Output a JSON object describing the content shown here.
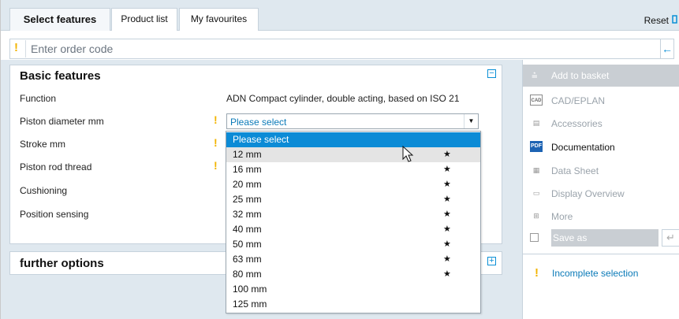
{
  "tabs": [
    {
      "label": "Select features",
      "active": true
    },
    {
      "label": "Product list",
      "active": false
    },
    {
      "label": "My favourites",
      "active": false
    }
  ],
  "reset_label": "Reset",
  "order_code": {
    "placeholder": "Enter order code",
    "value": ""
  },
  "basic_features": {
    "title": "Basic features",
    "rows": [
      {
        "label": "Function",
        "value": "ADN Compact cylinder, double acting, based on ISO 21",
        "required": false
      },
      {
        "label": "Piston diameter mm",
        "value": "",
        "required": true
      },
      {
        "label": "Stroke mm",
        "value": "",
        "required": true
      },
      {
        "label": "Piston rod thread",
        "value": "",
        "required": true
      },
      {
        "label": "Cushioning",
        "value": "",
        "required": false
      },
      {
        "label": "Position sensing",
        "value": "",
        "required": false
      }
    ],
    "select_value": "Please select"
  },
  "further_options": {
    "title": "further options"
  },
  "dropdown": {
    "options": [
      {
        "label": "Please select",
        "starred": false,
        "state": "selected"
      },
      {
        "label": "12 mm",
        "starred": true,
        "state": "hover"
      },
      {
        "label": "16 mm",
        "starred": true,
        "state": ""
      },
      {
        "label": "20 mm",
        "starred": true,
        "state": ""
      },
      {
        "label": "25 mm",
        "starred": true,
        "state": ""
      },
      {
        "label": "32 mm",
        "starred": true,
        "state": ""
      },
      {
        "label": "40 mm",
        "starred": true,
        "state": ""
      },
      {
        "label": "50 mm",
        "starred": true,
        "state": ""
      },
      {
        "label": "63 mm",
        "starred": true,
        "state": ""
      },
      {
        "label": "80 mm",
        "starred": true,
        "state": ""
      },
      {
        "label": "100 mm",
        "starred": false,
        "state": ""
      },
      {
        "label": "125 mm",
        "starred": false,
        "state": ""
      }
    ],
    "star_glyph": "★"
  },
  "actions": {
    "add_to_basket": "Add to basket",
    "cad_eplan": "CAD/EPLAN",
    "accessories": "Accessories",
    "documentation": "Documentation",
    "data_sheet": "Data Sheet",
    "display_overview": "Display Overview",
    "more": "More",
    "save_as": "Save as"
  },
  "icons": {
    "cad": "CAD",
    "pdf": "PDF"
  },
  "status": {
    "incomplete": "Incomplete selection"
  },
  "colors": {
    "accent": "#0c8bd6",
    "warning": "#f2b400",
    "panel_bg": "#dfe8ef"
  }
}
